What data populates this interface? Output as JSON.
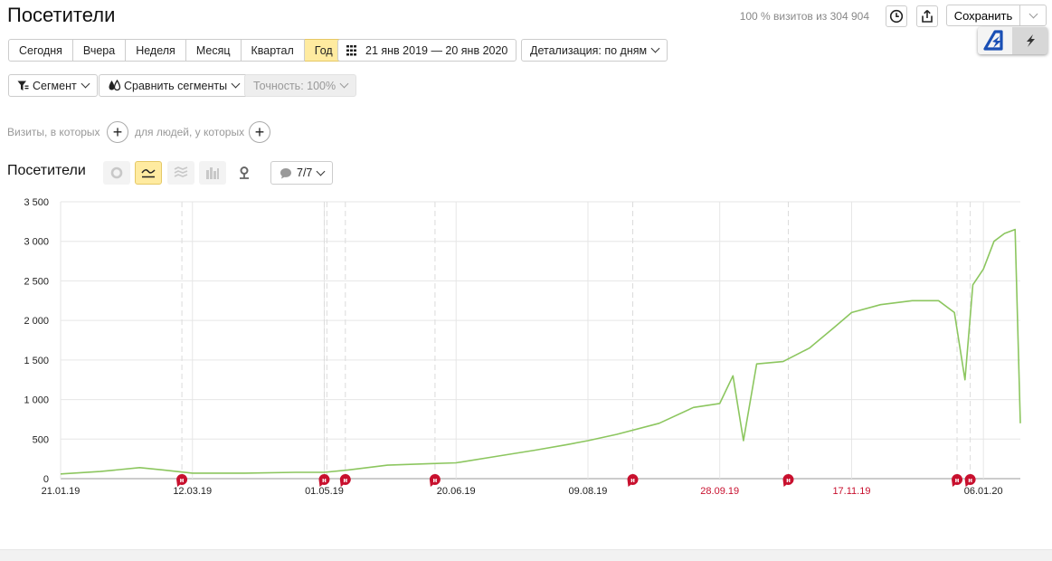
{
  "header": {
    "title": "Посетители",
    "summary": "100 % визитов из 304 904",
    "save_label": "Сохранить"
  },
  "periods": [
    {
      "label": "Сегодня",
      "active": false
    },
    {
      "label": "Вчера",
      "active": false
    },
    {
      "label": "Неделя",
      "active": false
    },
    {
      "label": "Месяц",
      "active": false
    },
    {
      "label": "Квартал",
      "active": false
    },
    {
      "label": "Год",
      "active": true
    }
  ],
  "date_range": "21 янв 2019 — 20 янв 2020",
  "detail": "Детализация: по дням",
  "segment": "Сегмент",
  "compare": "Сравнить сегменты",
  "accuracy": "Точность: 100%",
  "conditions": {
    "visits_label": "Визиты, в которых",
    "people_label": "для людей, у которых"
  },
  "chart_header": {
    "title": "Посетители",
    "notes_count": "7/7"
  },
  "colors": {
    "accent": "#ffeba0",
    "line": "#8cc65f",
    "marker": "#c8102e",
    "holiday_label": "#c8102e"
  },
  "icons": [
    "clock-icon",
    "share-icon",
    "chevron-down-icon",
    "calendar-icon",
    "filter-icon",
    "compare-icon",
    "plus-icon",
    "pie-icon",
    "line-chart-icon",
    "area-chart-icon",
    "bar-chart-icon",
    "map-pin-icon",
    "comment-icon"
  ],
  "chart_data": {
    "type": "line",
    "title": "",
    "xlabel": "",
    "ylabel": "",
    "ylim": [
      0,
      3500
    ],
    "ytick_labels": [
      "0",
      "500",
      "1 000",
      "1 500",
      "2 000",
      "2 500",
      "3 000",
      "3 500"
    ],
    "xtick_labels": [
      {
        "label": "21.01.19",
        "holiday": false
      },
      {
        "label": "12.03.19",
        "holiday": false
      },
      {
        "label": "01.05.19",
        "holiday": false
      },
      {
        "label": "20.06.19",
        "holiday": false
      },
      {
        "label": "09.08.19",
        "holiday": false
      },
      {
        "label": "28.09.19",
        "holiday": true
      },
      {
        "label": "17.11.19",
        "holiday": true
      },
      {
        "label": "06.01.20",
        "holiday": false
      }
    ],
    "x_start": "2019-01-21",
    "x_end": "2020-01-20",
    "grid": true,
    "series": [
      {
        "values": [
          {
            "x": "2019-01-21",
            "y": 60
          },
          {
            "x": "2019-02-05",
            "y": 90
          },
          {
            "x": "2019-02-20",
            "y": 140
          },
          {
            "x": "2019-03-01",
            "y": 110
          },
          {
            "x": "2019-03-12",
            "y": 70
          },
          {
            "x": "2019-04-01",
            "y": 70
          },
          {
            "x": "2019-04-20",
            "y": 80
          },
          {
            "x": "2019-05-01",
            "y": 80
          },
          {
            "x": "2019-05-10",
            "y": 110
          },
          {
            "x": "2019-05-25",
            "y": 170
          },
          {
            "x": "2019-06-10",
            "y": 190
          },
          {
            "x": "2019-06-20",
            "y": 200
          },
          {
            "x": "2019-07-05",
            "y": 280
          },
          {
            "x": "2019-07-20",
            "y": 360
          },
          {
            "x": "2019-08-01",
            "y": 430
          },
          {
            "x": "2019-08-09",
            "y": 480
          },
          {
            "x": "2019-08-20",
            "y": 560
          },
          {
            "x": "2019-09-05",
            "y": 700
          },
          {
            "x": "2019-09-18",
            "y": 900
          },
          {
            "x": "2019-09-28",
            "y": 950
          },
          {
            "x": "2019-10-03",
            "y": 1300
          },
          {
            "x": "2019-10-07",
            "y": 480
          },
          {
            "x": "2019-10-12",
            "y": 1450
          },
          {
            "x": "2019-10-22",
            "y": 1480
          },
          {
            "x": "2019-11-01",
            "y": 1650
          },
          {
            "x": "2019-11-10",
            "y": 1900
          },
          {
            "x": "2019-11-17",
            "y": 2100
          },
          {
            "x": "2019-11-28",
            "y": 2200
          },
          {
            "x": "2019-12-10",
            "y": 2250
          },
          {
            "x": "2019-12-20",
            "y": 2250
          },
          {
            "x": "2019-12-26",
            "y": 2100
          },
          {
            "x": "2019-12-30",
            "y": 1250
          },
          {
            "x": "2020-01-02",
            "y": 2450
          },
          {
            "x": "2020-01-06",
            "y": 2650
          },
          {
            "x": "2020-01-10",
            "y": 3000
          },
          {
            "x": "2020-01-14",
            "y": 3100
          },
          {
            "x": "2020-01-18",
            "y": 3150
          },
          {
            "x": "2020-01-20",
            "y": 700
          }
        ]
      }
    ]
  }
}
